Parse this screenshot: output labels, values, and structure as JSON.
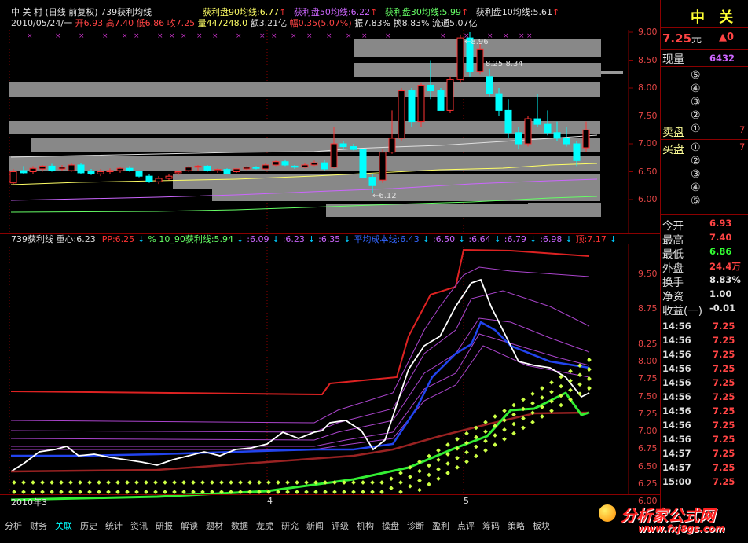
{
  "title": {
    "name": "中 关 村",
    "mode": "(日线 前复权)",
    "indicator": "739获利均线"
  },
  "top_legend": [
    {
      "text": "获利盘90均线:6.77",
      "color": "#ffff66"
    },
    {
      "text": "获利盘50均线:6.22",
      "color": "#cc66ff"
    },
    {
      "text": "获利盘30均线:5.99",
      "color": "#66ff66"
    },
    {
      "text": "获利盘10均线:5.61",
      "color": "#e0e0e0"
    }
  ],
  "quote_line": {
    "date": "2010/05/24/一",
    "open": "开6.93",
    "high": "高7.40",
    "low": "低6.86",
    "close": "收7.25",
    "volume": "量447248.0",
    "amount": "额3.21亿",
    "change": "幅0.35(5.07%)",
    "amplitude": "振7.83%",
    "turnover": "换8.83%",
    "float": "流通5.07亿"
  },
  "upper_chart": {
    "y_ticks": [
      "9.00",
      "8.50",
      "8.00",
      "7.50",
      "7.00",
      "6.50",
      "6.00"
    ],
    "annotations": {
      "high": "8.96",
      "mid": "8.25 8.34",
      "low": "6.12"
    }
  },
  "lower_legend": [
    {
      "text": "739获利线 重心:6.23",
      "color": "#e0e0e0"
    },
    {
      "text": "PP:6.25",
      "color": "#ff3333"
    },
    {
      "text": "% 10_90获利线:5.94",
      "color": "#66ff66"
    },
    {
      "text": ":6.09",
      "color": "#cc66ff"
    },
    {
      "text": ":6.23",
      "color": "#cc66ff"
    },
    {
      "text": ":6.35",
      "color": "#cc66ff"
    },
    {
      "text": "平均成本线:6.43",
      "color": "#3366ff"
    },
    {
      "text": ":6.50",
      "color": "#cc66ff"
    },
    {
      "text": ":6.64",
      "color": "#cc66ff"
    },
    {
      "text": ":6.79",
      "color": "#cc66ff"
    },
    {
      "text": ":6.98",
      "color": "#cc66ff"
    },
    {
      "text": "顶:7.17",
      "color": "#ff3333"
    }
  ],
  "lower_chart": {
    "y_ticks": [
      "9.50",
      "8.75",
      "8.25",
      "8.00",
      "7.75",
      "7.50",
      "7.25",
      "7.00",
      "6.75",
      "6.50",
      "6.25",
      "6.00"
    ]
  },
  "x_axis": {
    "labels": [
      "2010年3",
      "4",
      "5"
    ]
  },
  "side_panel": {
    "stock_name": "中 关",
    "price": "7.25",
    "price_unit": "元",
    "price_change": "▲0",
    "volume_label": "现量",
    "volume_value": "6432",
    "ask_label": "卖盘",
    "bid_label": "买盘",
    "ask_levels": [
      "⑤",
      "④",
      "③",
      "②",
      "①"
    ],
    "bid_levels": [
      "①",
      "②",
      "③",
      "④",
      "⑤"
    ],
    "stats": [
      {
        "label": "今开",
        "value": "6.93",
        "color": "#ff4444"
      },
      {
        "label": "最高",
        "value": "7.40",
        "color": "#ff4444"
      },
      {
        "label": "最低",
        "value": "6.86",
        "color": "#33ff33"
      },
      {
        "label": "外盘",
        "value": "24.4万",
        "color": "#ff4444"
      },
      {
        "label": "换手",
        "value": "8.83%",
        "color": "#e0e0e0"
      },
      {
        "label": "净资",
        "value": "1.00",
        "color": "#e0e0e0"
      },
      {
        "label": "收益(一)",
        "value": "-0.01",
        "color": "#e0e0e0"
      }
    ],
    "ticks": [
      {
        "time": "14:56",
        "price": "7.25"
      },
      {
        "time": "14:56",
        "price": "7.25"
      },
      {
        "time": "14:56",
        "price": "7.25"
      },
      {
        "time": "14:56",
        "price": "7.25"
      },
      {
        "time": "14:56",
        "price": "7.25"
      },
      {
        "time": "14:56",
        "price": "7.25"
      },
      {
        "time": "14:56",
        "price": "7.25"
      },
      {
        "time": "14:56",
        "price": "7.25"
      },
      {
        "time": "14:56",
        "price": "7.25"
      },
      {
        "time": "14:57",
        "price": "7.25"
      },
      {
        "time": "14:57",
        "price": "7.25"
      },
      {
        "time": "15:00",
        "price": "7.25"
      }
    ]
  },
  "bottom_tabs": [
    "分析",
    "财务",
    "关联",
    "历史",
    "统计",
    "资讯",
    "研报",
    "解读",
    "题材",
    "数据",
    "龙虎",
    "研究",
    "新闻",
    "评级",
    "机构",
    "操盘",
    "诊断",
    "盈利",
    "点评",
    "筹码",
    "策略",
    "板块"
  ],
  "watermark": {
    "text": "分析家公式网",
    "url": "www.fxj8gs.com"
  },
  "colors": {
    "up": "#ff3333",
    "down": "#00ffff",
    "grid": "#8b0000",
    "bg": "#000000"
  }
}
